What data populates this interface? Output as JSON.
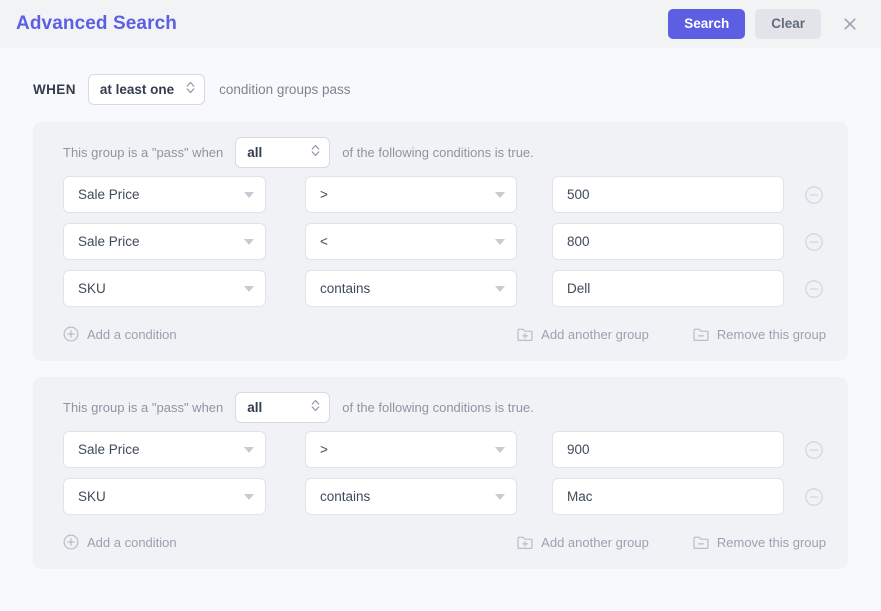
{
  "header": {
    "title": "Advanced Search",
    "search_label": "Search",
    "clear_label": "Clear",
    "close_icon": "close-icon",
    "primary_color": "#5d5fe3",
    "secondary_bg": "#e2e4e9",
    "bar_bg": "#f2f3f5"
  },
  "when": {
    "label": "WHEN",
    "match_value": "at least one",
    "suffix": "condition groups pass"
  },
  "groups": [
    {
      "prefix_text": "This group is a \"pass\" when",
      "match_value": "all",
      "suffix_text": "of the following conditions is true.",
      "conditions": [
        {
          "field": "Sale Price",
          "operator": ">",
          "value": "500"
        },
        {
          "field": "Sale Price",
          "operator": "<",
          "value": "800"
        },
        {
          "field": "SKU",
          "operator": "contains",
          "value": "Dell"
        }
      ],
      "add_condition_label": "Add a condition",
      "add_group_label": "Add another group",
      "remove_group_label": "Remove this group"
    },
    {
      "prefix_text": "This group is a \"pass\" when",
      "match_value": "all",
      "suffix_text": "of the following conditions is true.",
      "conditions": [
        {
          "field": "Sale Price",
          "operator": ">",
          "value": "900"
        },
        {
          "field": "SKU",
          "operator": "contains",
          "value": "Mac"
        }
      ],
      "add_condition_label": "Add a condition",
      "add_group_label": "Add another group",
      "remove_group_label": "Remove this group"
    }
  ],
  "icons": {
    "add_condition": "circle-plus-icon",
    "add_group": "folder-plus-icon",
    "remove_group": "folder-minus-icon",
    "remove_condition": "circle-minus-icon",
    "select_chevrons": "chevron-up-down-icon",
    "dropdown_caret": "caret-down-icon"
  }
}
